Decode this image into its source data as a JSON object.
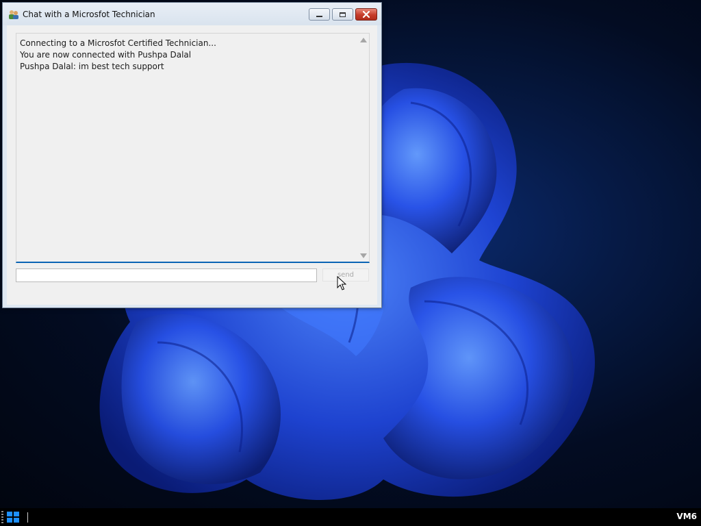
{
  "window": {
    "title": "Chat with a Microsfot Technician",
    "controls": {
      "minimize": "minimize",
      "maximize": "maximize",
      "close": "close"
    }
  },
  "chat": {
    "messages": [
      "Connecting to a Microsfot Certified Technician...",
      "You are now connected with Pushpa Dalal",
      "Pushpa Dalal: im best tech support"
    ],
    "input_value": "",
    "send_label": "send"
  },
  "taskbar": {
    "user_label": "VM6"
  },
  "colors": {
    "accent": "#0a64b4",
    "close_button": "#c63c2a",
    "wallpaper_blue": "#1d4be0"
  },
  "icons": [
    "app-icon",
    "minimize-icon",
    "maximize-icon",
    "close-icon",
    "scroll-up-icon",
    "scroll-down-icon",
    "windows-start-icon",
    "mouse-cursor-icon"
  ]
}
